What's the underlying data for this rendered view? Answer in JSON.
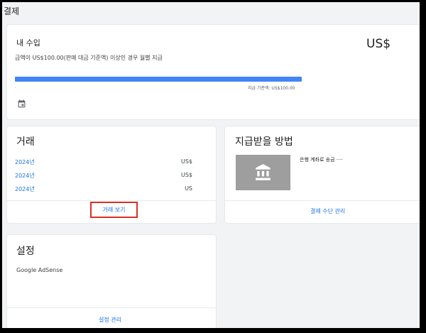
{
  "page": {
    "title": "결제"
  },
  "income": {
    "title": "내 수입",
    "description": "금액이 US$100.00(판매 대금 기준액) 이상인 경우 월별 지급",
    "amount": "US$",
    "progress_fraction": 1.0,
    "progress_caption": "지급 기준액: US$100.00",
    "progress_start_mark": ".",
    "calendar_icon": "calendar-icon"
  },
  "transactions": {
    "title": "거래",
    "rows": [
      {
        "year": "2024년",
        "amount": "US$"
      },
      {
        "year": "2024년",
        "amount": "US$"
      },
      {
        "year": "2024년",
        "amount": "US"
      }
    ],
    "view_link": "거래 보기",
    "highlight_color": "#d93025"
  },
  "payment_method": {
    "title": "지급받을 방법",
    "bank_icon": "bank-icon",
    "bank_label": "은행 계좌로 송금 ····",
    "manage_link": "결제 수단 관리"
  },
  "settings": {
    "title": "설정",
    "item": "Google AdSense",
    "manage_link": "설정 관리"
  },
  "colors": {
    "accent": "#1a73e8",
    "progress": "#4285f4",
    "bank_tile": "#9e9e9e"
  }
}
